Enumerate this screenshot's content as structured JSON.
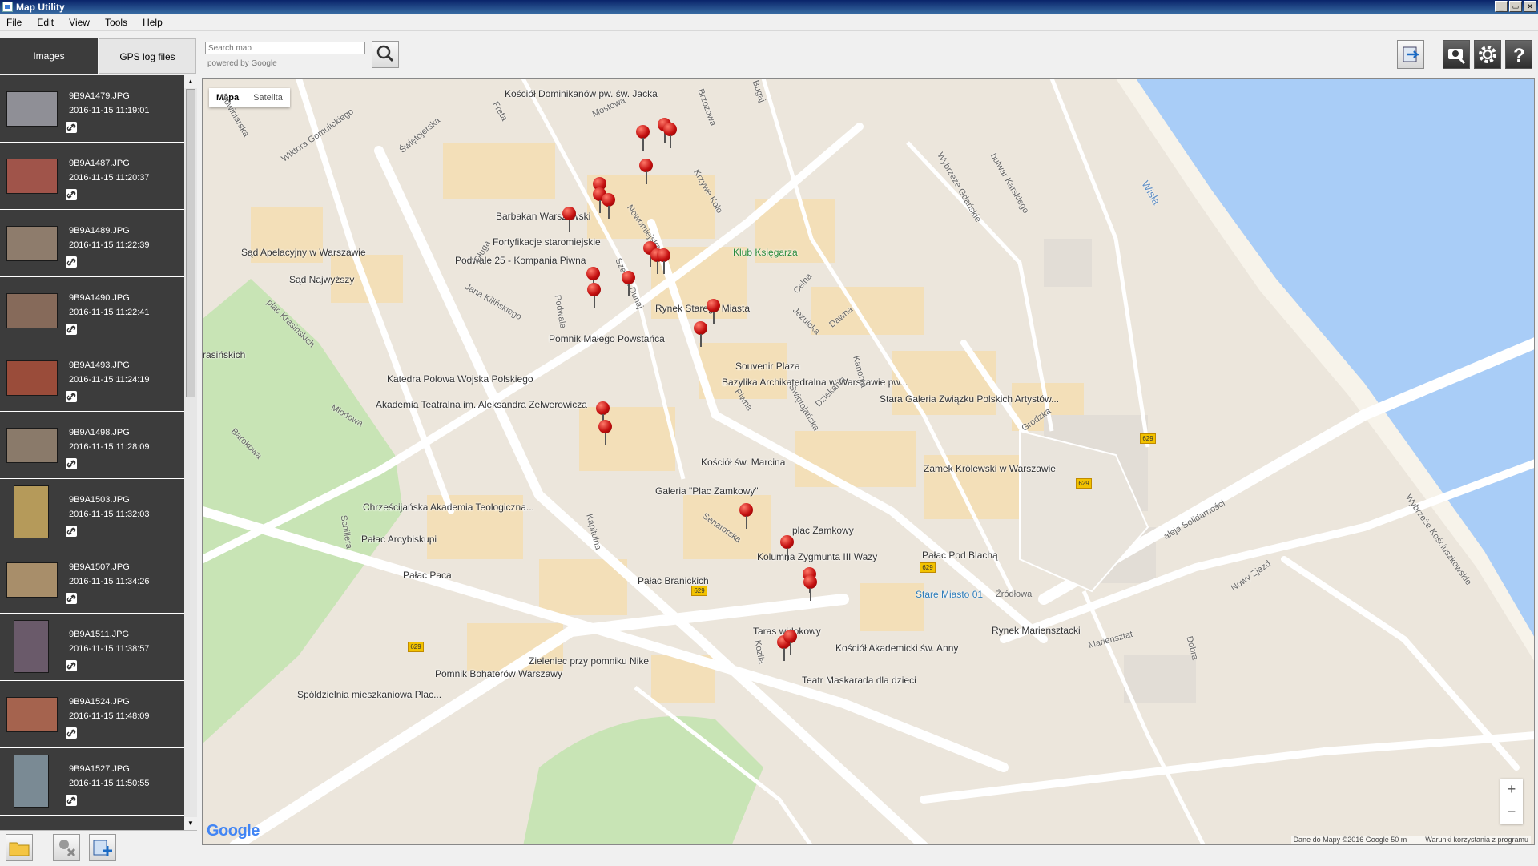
{
  "window": {
    "title": "Map Utility"
  },
  "menu": [
    "File",
    "Edit",
    "View",
    "Tools",
    "Help"
  ],
  "tabs": {
    "images": "Images",
    "gps": "GPS log files"
  },
  "search": {
    "placeholder": "Search map",
    "powered": "powered by Google"
  },
  "images": [
    {
      "name": "9B9A1479.JPG",
      "date": "2016-11-15 11:19:01",
      "color": "#8f8f96"
    },
    {
      "name": "9B9A1487.JPG",
      "date": "2016-11-15 11:20:37",
      "color": "#a0544a"
    },
    {
      "name": "9B9A1489.JPG",
      "date": "2016-11-15 11:22:39",
      "color": "#8e7c6c"
    },
    {
      "name": "9B9A1490.JPG",
      "date": "2016-11-15 11:22:41",
      "color": "#866a5a"
    },
    {
      "name": "9B9A1493.JPG",
      "date": "2016-11-15 11:24:19",
      "color": "#9a4c3a"
    },
    {
      "name": "9B9A1498.JPG",
      "date": "2016-11-15 11:28:09",
      "color": "#8a7a6a"
    },
    {
      "name": "9B9A1503.JPG",
      "date": "2016-11-15 11:32:03",
      "color": "#b59a5a",
      "portrait": true
    },
    {
      "name": "9B9A1507.JPG",
      "date": "2016-11-15 11:34:26",
      "color": "#a88e6a"
    },
    {
      "name": "9B9A1511.JPG",
      "date": "2016-11-15 11:38:57",
      "color": "#6a5a6a",
      "portrait": true
    },
    {
      "name": "9B9A1524.JPG",
      "date": "2016-11-15 11:48:09",
      "color": "#a5634e"
    },
    {
      "name": "9B9A1527.JPG",
      "date": "2016-11-15 11:50:55",
      "color": "#7a8a94",
      "portrait": true
    }
  ],
  "map": {
    "type_map": "Mapa",
    "type_sat": "Satelita",
    "zoom_in": "+",
    "zoom_out": "−",
    "logo": "Google",
    "attribution": "Dane do Mapy ©2016 Google    50 m ⎯⎯⎯⎯    Warunki korzystania z programu",
    "places": [
      "Kościół Dominikanów pw. św. Jacka",
      "Barbakan Warszawski",
      "Fortyfikacje staromiejskie",
      "Podwale 25 - Kompania Piwna",
      "Sąd Apelacyjny w Warszawie",
      "Sąd Najwyższy",
      "Klub Księgarza",
      "Rynek Starego Miasta",
      "Pomnik Małego Powstańca",
      "Souvenir Plaza",
      "Bazylika Archikatedralna w Warszawie pw...",
      "Stara Galeria Związku Polskich Artystów...",
      "Katedra Polowa Wojska Polskiego",
      "Akademia Teatralna im. Aleksandra Zelwerowicza",
      "Kościół św. Marcina",
      "Zamek Królewski w Warszawie",
      "Galeria \"Plac Zamkowy\"",
      "Chrześcijańska Akademia Teologiczna...",
      "plac Zamkowy",
      "Pałac Arcybiskupi",
      "Kolumna Zygmunta III Wazy",
      "Pałac Pod Blachą",
      "Pałac Paca",
      "Pałac Branickich",
      "Stare Miasto 01",
      "Taras widokowy",
      "Kościół Akademicki św. Anny",
      "Rynek Mariensztacki",
      "Zieleniec przy pomniku Nike",
      "Pomnik Bohaterów Warszawy",
      "Teatr Maskarada dla dzieci",
      "Spółdzielnia mieszkaniowa Plac...",
      "rasińskich"
    ],
    "streets": [
      "Mostowa",
      "Brzozowa",
      "Bugaj",
      "Freta",
      "Świętojerska",
      "Nowiniarska",
      "Wiktora Gomulickiego",
      "Nowomiejska",
      "Krzywe Koło",
      "Wybrzeże Gdańskie",
      "bulwar Karskiego",
      "Wisła",
      "Długa",
      "Jana Kilińskiego",
      "Podwale",
      "Szeroki Dunaj",
      "Celna",
      "Jezuicka",
      "Dawna",
      "Kanonia",
      "Piwna",
      "Świętojańska",
      "Dziekania",
      "Miodowa",
      "Senatorska",
      "Grodzka",
      "aleja Solidarności",
      "Mariensztat",
      "Nowy Zjazd",
      "Źródłowa",
      "Wybrzeże Kościuszkowskie",
      "Barokowa",
      "Schillera",
      "Kapitulna",
      "Koziia",
      "plac Krasińskich",
      "Dobra"
    ],
    "road_number": "629",
    "pins": 24
  }
}
